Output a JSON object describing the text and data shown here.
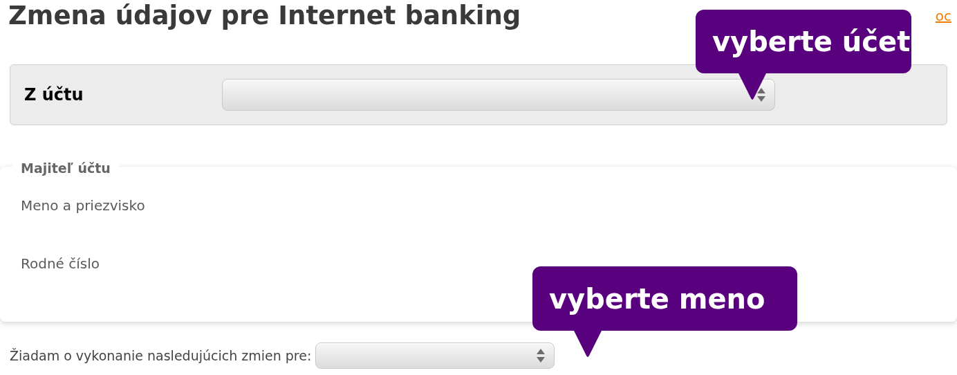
{
  "title": "Zmena údajov pre Internet banking",
  "help_link": {
    "label": "oc"
  },
  "account_panel": {
    "label": "Z účtu"
  },
  "owner": {
    "legend": "Majiteľ účtu",
    "fields": [
      "Meno a priezvisko",
      "Rodné číslo"
    ]
  },
  "change_request": {
    "label": "Žiadam o vykonanie nasledujúcich zmien pre:"
  },
  "callouts": [
    {
      "text": "vyberte účet"
    },
    {
      "text": "vyberte meno"
    }
  ]
}
